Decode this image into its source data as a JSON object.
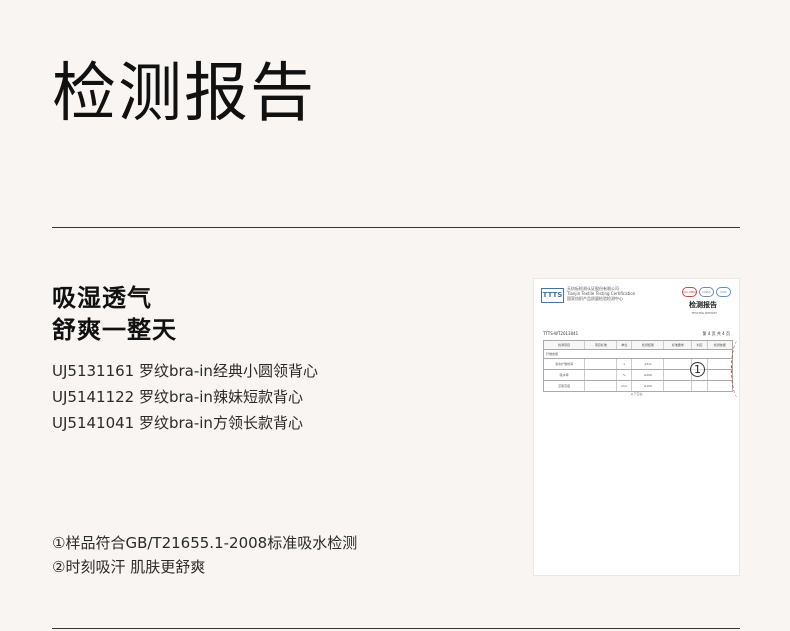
{
  "page": {
    "title": "检测报告",
    "headline_1": "吸湿透气",
    "headline_2": "舒爽一整天",
    "products": [
      "UJ5131161 罗纹bra-in经典小圆领背心",
      "UJ5141122 罗纹bra-in辣妹短款背心",
      "UJ5141041 罗纹bra-in方领长款背心"
    ],
    "notes": [
      "①样品符合GB/T21655.1-2008标准吸水检测",
      "②时刻吸汗 肌肤更舒爽"
    ]
  },
  "report": {
    "logo": "TTTS",
    "org_lines": [
      "天纺标检测认证股份有限公司",
      "Tianjin Textile Testing Certification",
      "国家纺织产品质量检验检测中心"
    ],
    "title": "检测报告",
    "subtitle": "TESTING REPORT",
    "marks": [
      "ilac-MRA",
      "CNAS",
      "CMA"
    ],
    "report_no": "TTTS-WT2013041",
    "page_no": "第 4 页 共 4 页",
    "table_head": [
      "检测项目",
      "项目标准",
      "单位",
      "检测结果",
      "标准要求",
      "判定",
      "检测依据"
    ],
    "table_rows": [
      [
        "纤维含量",
        "",
        "",
        "",
        "",
        "",
        ""
      ],
      [
        "滴水扩散时间",
        "",
        "s",
        "≤3.0",
        "",
        "",
        ""
      ],
      [
        "吸水率",
        "",
        "%",
        "≥200",
        "",
        "",
        ""
      ],
      [
        "芯吸高度",
        "",
        "mm",
        "≥100",
        "",
        "",
        ""
      ]
    ],
    "stamp": "1",
    "footer": "以下空白"
  }
}
